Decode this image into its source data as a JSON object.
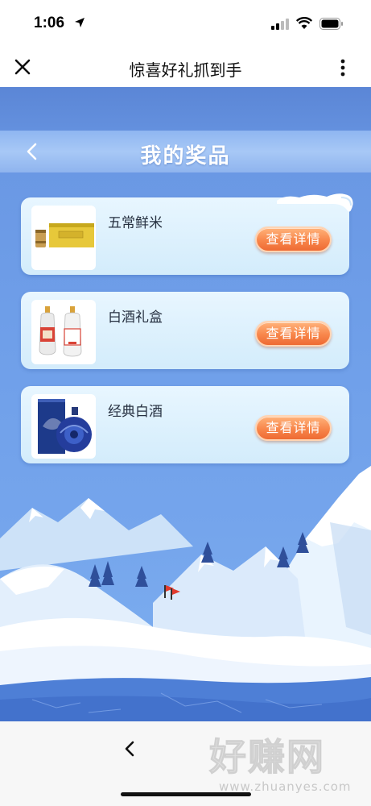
{
  "status_bar": {
    "time": "1:06"
  },
  "nav": {
    "title": "惊喜好礼抓到手"
  },
  "page": {
    "title": "我的奖品"
  },
  "prizes": [
    {
      "name": "五常鲜米",
      "button": "查看详情"
    },
    {
      "name": "白酒礼盒",
      "button": "查看详情"
    },
    {
      "name": "经典白酒",
      "button": "查看详情"
    }
  ],
  "watermark": {
    "text": "好赚网",
    "url": "www.zhuanyes.com"
  },
  "colors": {
    "button_orange": "#f8864b",
    "background_blue": "#6f9fe9",
    "card_bg": "#e2f3fd"
  },
  "icons": [
    "location-arrow-icon",
    "signal-icon",
    "wifi-icon",
    "battery-icon",
    "close-icon",
    "more-icon",
    "chevron-left-icon"
  ]
}
